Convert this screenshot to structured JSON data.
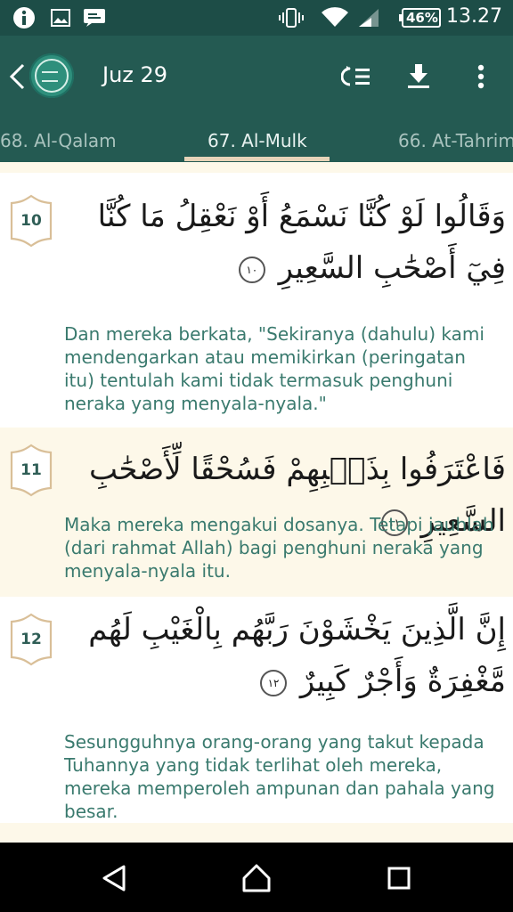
{
  "status_bar": {
    "time": "13.27",
    "battery": "46%",
    "icons": [
      "notification-q-icon",
      "image-icon",
      "message-icon",
      "vibrate-icon",
      "wifi-icon",
      "signal-icon",
      "battery-icon"
    ]
  },
  "app_bar": {
    "title": "Juz 29",
    "actions": [
      "playlist-icon",
      "download-icon",
      "more-icon"
    ]
  },
  "tabs": [
    {
      "label": "68. Al-Qalam",
      "active": false
    },
    {
      "label": "67. Al-Mulk",
      "active": true
    },
    {
      "label": "66. At-Tahrim",
      "active": false
    }
  ],
  "verses": [
    {
      "number": "10",
      "arabic": "وَقَالُوا لَوْ كُنَّا نَسْمَعُ أَوْ نَعْقِلُ مَا كُنَّا فِيٓ أَصْحَٰبِ السَّعِيرِ",
      "end_mark": "١٠",
      "translation": "Dan mereka berkata, \"Sekiranya (dahulu) kami mendengarkan atau memikirkan (peringatan itu) tentulah kami tidak termasuk penghuni neraka yang menyala-nyala.\""
    },
    {
      "number": "11",
      "arabic": "فَاعْتَرَفُوا بِذَنۢبِهِمْ فَسُحْقًا لِّأَصْحَٰبِ السَّعِيرِ",
      "end_mark": "١١",
      "translation": "Maka mereka mengakui dosanya. Tetapi jauhlah (dari rahmat Allah) bagi penghuni neraka yang menyala-nyala itu."
    },
    {
      "number": "12",
      "arabic": "إِنَّ الَّذِينَ يَخْشَوْنَ رَبَّهُم بِالْغَيْبِ لَهُم مَّغْفِرَةٌ وَأَجْرٌ كَبِيرٌ",
      "end_mark": "١٢",
      "translation": "Sesungguhnya orang-orang yang takut kepada Tuhannya yang tidak terlihat oleh mereka, mereka memperoleh ampunan dan pahala yang besar."
    }
  ],
  "colors": {
    "status_bar": "#1d4d47",
    "app_bar": "#245a52",
    "accent": "#e6d3b8",
    "translation_text": "#3a7a6e",
    "alt_row": "#fdf8e9"
  },
  "nav_bar": [
    "back-triangle-icon",
    "home-circle-icon",
    "recents-square-icon"
  ]
}
